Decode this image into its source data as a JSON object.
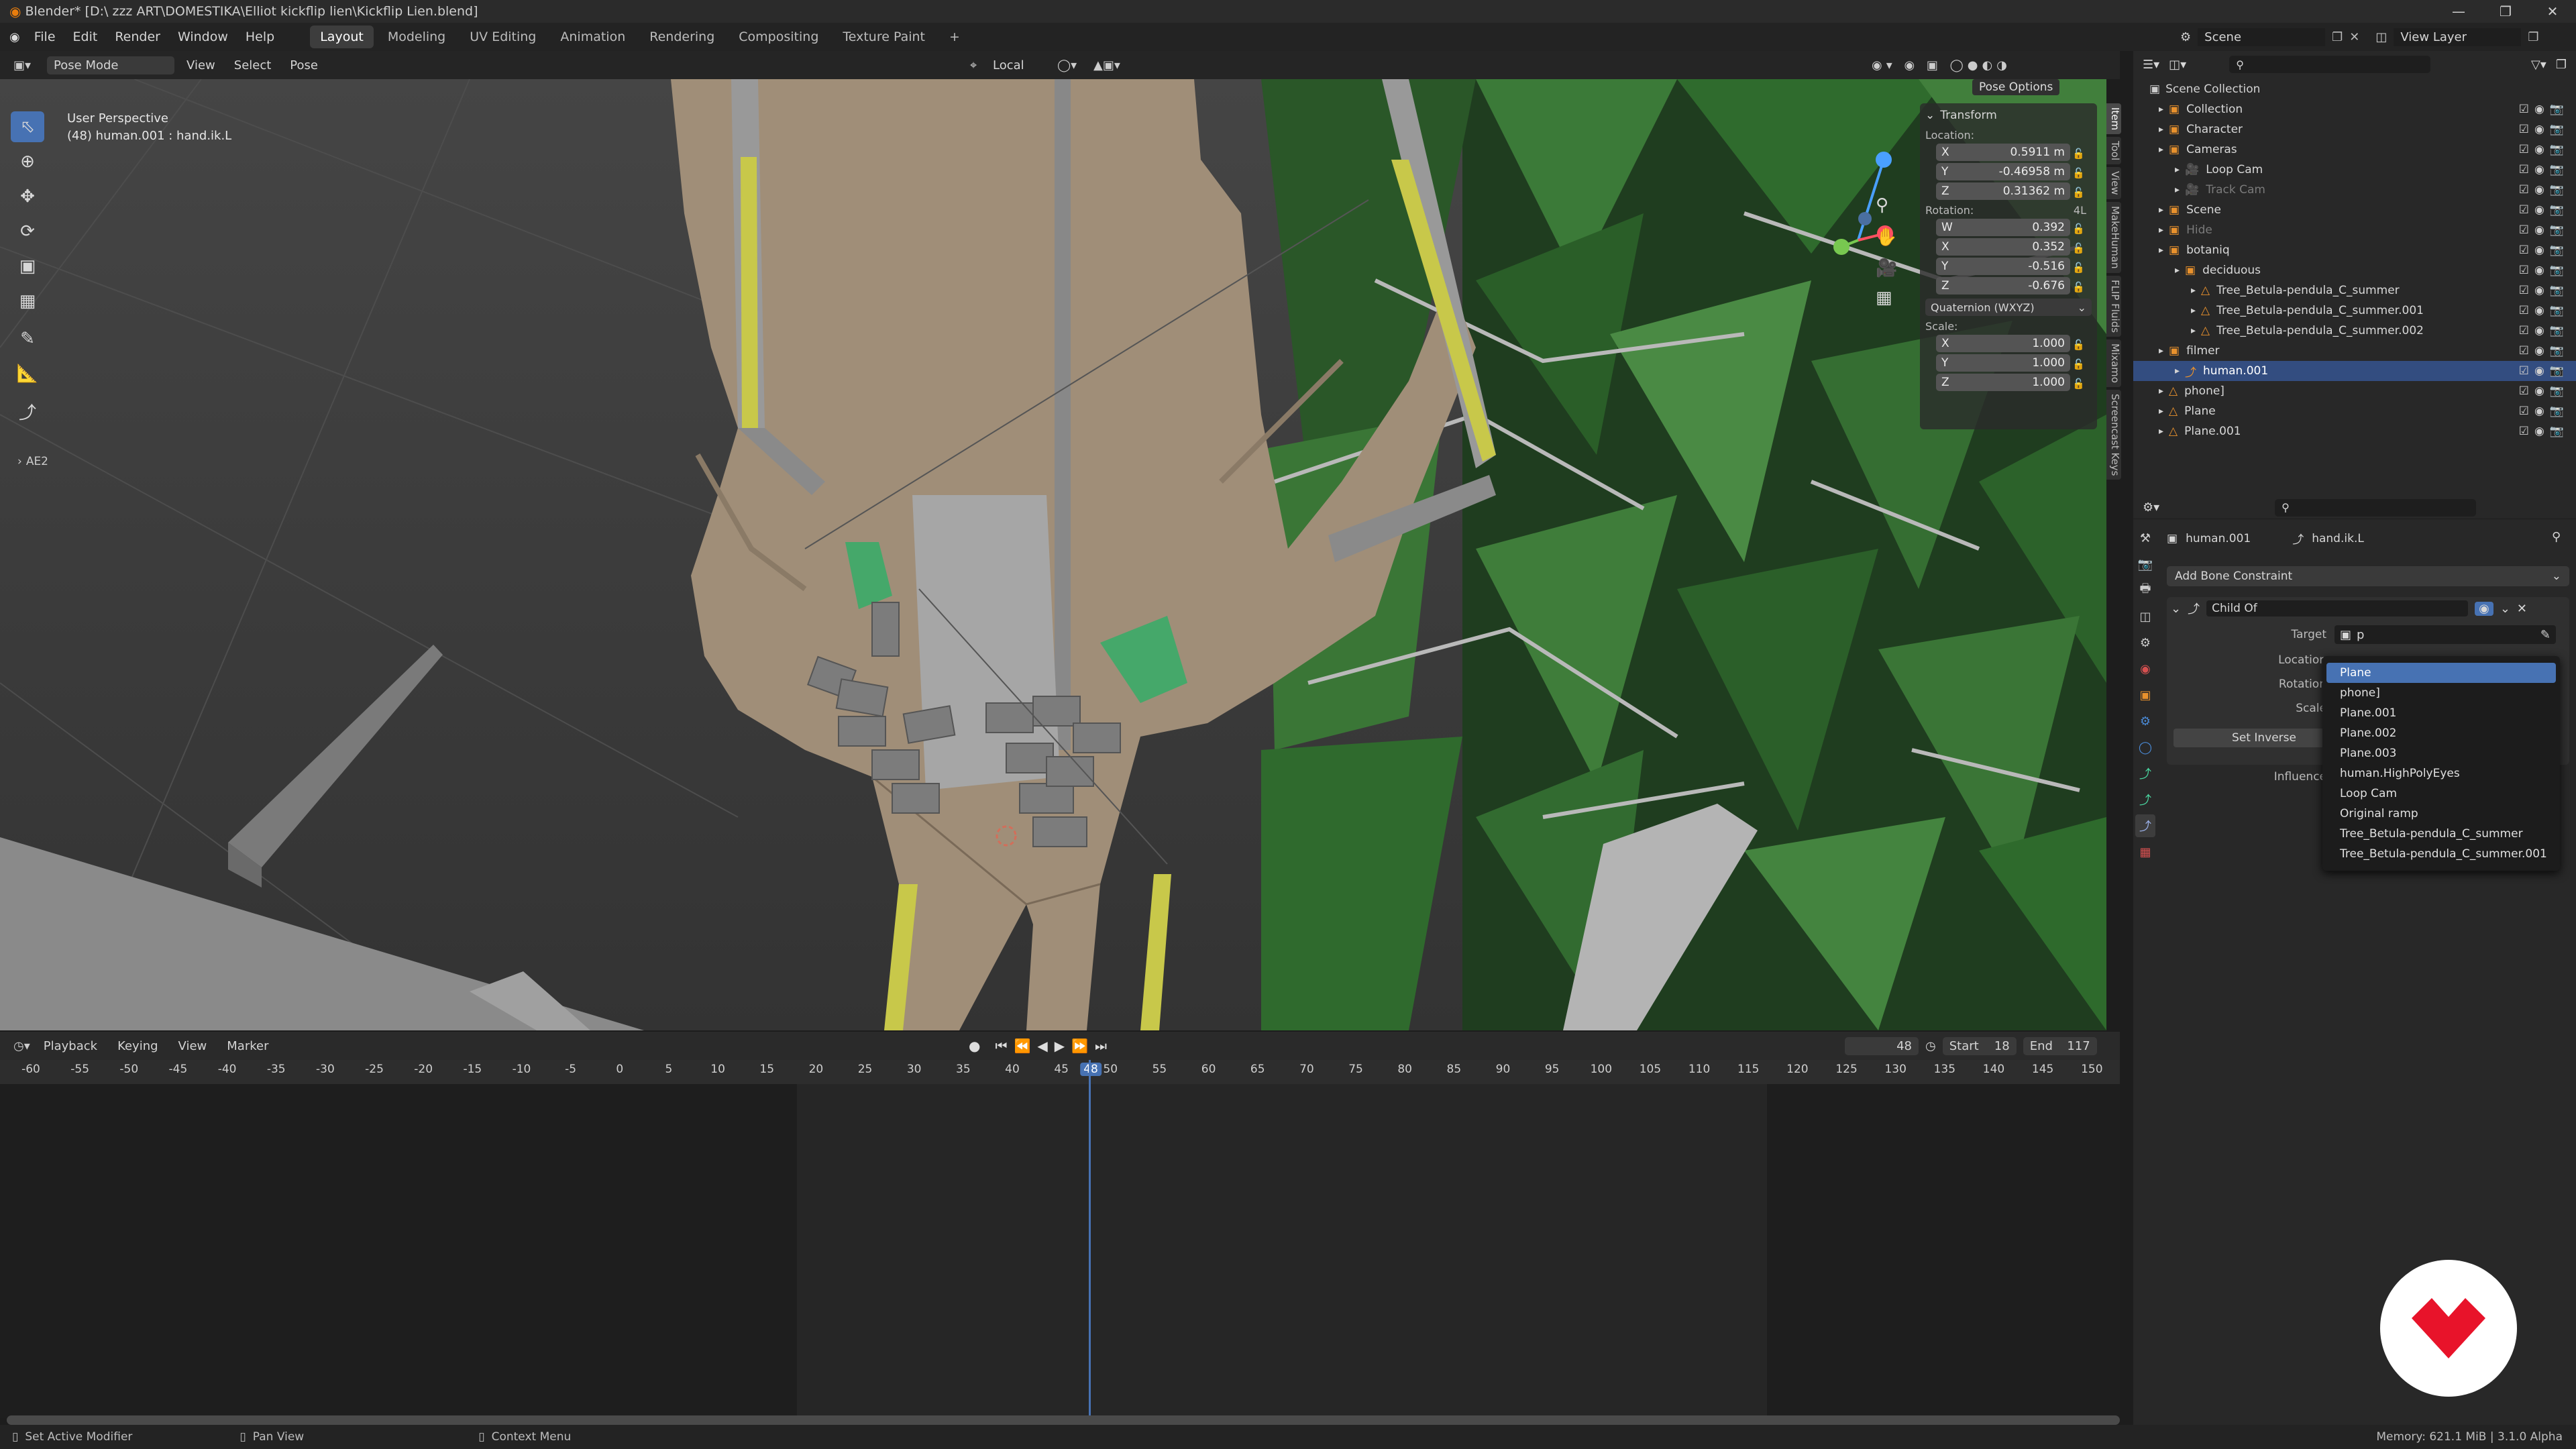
{
  "titlebar": {
    "title": "Blender* [D:\\ zzz ART\\DOMESTIKA\\Elliot kickflip lien\\Kickflip Lien.blend]"
  },
  "menu": {
    "items": [
      "File",
      "Edit",
      "Render",
      "Window",
      "Help"
    ]
  },
  "workspaces": [
    "Layout",
    "Modeling",
    "UV Editing",
    "Animation",
    "Rendering",
    "Compositing",
    "Texture Paint",
    "+"
  ],
  "top_right": {
    "scene": "Scene",
    "view_layer": "View Layer"
  },
  "viewport_header": {
    "mode": "Pose Mode",
    "menus": [
      "View",
      "Select",
      "Pose"
    ],
    "orientation": "Local",
    "pose_options": "Pose Options"
  },
  "viewport": {
    "perspective": "User Perspective",
    "object_info": "(48) human.001 : hand.ik.L",
    "collapsed_panel": "AE2"
  },
  "transform": {
    "title": "Transform",
    "location_label": "Location:",
    "location": [
      {
        "axis": "X",
        "value": "0.5911 m"
      },
      {
        "axis": "Y",
        "value": "-0.46958 m"
      },
      {
        "axis": "Z",
        "value": "0.31362 m"
      }
    ],
    "rotation_label": "Rotation:",
    "rotation_mode_short": "4L",
    "rotation": [
      {
        "axis": "W",
        "value": "0.392"
      },
      {
        "axis": "X",
        "value": "0.352"
      },
      {
        "axis": "Y",
        "value": "-0.516"
      },
      {
        "axis": "Z",
        "value": "-0.676"
      }
    ],
    "rotation_mode": "Quaternion (WXYZ)",
    "scale_label": "Scale:",
    "scale": [
      {
        "axis": "X",
        "value": "1.000"
      },
      {
        "axis": "Y",
        "value": "1.000"
      },
      {
        "axis": "Z",
        "value": "1.000"
      }
    ]
  },
  "side_tabs": [
    "Item",
    "Tool",
    "View",
    "MakeHuman",
    "FLIP Fluids",
    "Mixamo",
    "Screencast Keys"
  ],
  "timeline": {
    "menus": [
      "Playback",
      "Keying",
      "View",
      "Marker"
    ],
    "current_frame": "48",
    "start_label": "Start",
    "start": "18",
    "end_label": "End",
    "end": "117",
    "ticks": [
      "-60",
      "-55",
      "-50",
      "-45",
      "-40",
      "-35",
      "-30",
      "-25",
      "-20",
      "-15",
      "-10",
      "-5",
      "0",
      "5",
      "10",
      "15",
      "20",
      "25",
      "30",
      "35",
      "40",
      "45",
      "48",
      "50",
      "55",
      "60",
      "65",
      "70",
      "75",
      "80",
      "85",
      "90",
      "95",
      "100",
      "105",
      "110",
      "115",
      "120",
      "125",
      "130",
      "135",
      "140",
      "145",
      "150"
    ]
  },
  "outliner": {
    "root": "Scene Collection",
    "rows": [
      {
        "label": "Collection",
        "indent": 1,
        "color": "#d8d8d8"
      },
      {
        "label": "Character",
        "indent": 1,
        "color": "#d8d8d8"
      },
      {
        "label": "Cameras",
        "indent": 1,
        "color": "#d8d8d8"
      },
      {
        "label": "Loop Cam",
        "indent": 2,
        "color": "#d8d8d8"
      },
      {
        "label": "Track Cam",
        "indent": 2,
        "color": "#7a7a7a"
      },
      {
        "label": "Scene",
        "indent": 1,
        "color": "#d8d8d8"
      },
      {
        "label": "Hide",
        "indent": 1,
        "color": "#7a7a7a"
      },
      {
        "label": "botaniq",
        "indent": 1,
        "color": "#d8d8d8"
      },
      {
        "label": "deciduous",
        "indent": 2,
        "color": "#d8d8d8"
      },
      {
        "label": "Tree_Betula-pendula_C_summer",
        "indent": 3,
        "color": "#d8d8d8"
      },
      {
        "label": "Tree_Betula-pendula_C_summer.001",
        "indent": 3,
        "color": "#d8d8d8"
      },
      {
        "label": "Tree_Betula-pendula_C_summer.002",
        "indent": 3,
        "color": "#d8d8d8"
      },
      {
        "label": "filmer",
        "indent": 1,
        "color": "#d8d8d8"
      },
      {
        "label": "human.001",
        "indent": 2,
        "color": "#ffffff"
      },
      {
        "label": "phone]",
        "indent": 1,
        "color": "#d8d8d8"
      },
      {
        "label": "Plane",
        "indent": 1,
        "color": "#d8d8d8"
      },
      {
        "label": "Plane.001",
        "indent": 1,
        "color": "#d8d8d8"
      }
    ]
  },
  "properties": {
    "object": "human.001",
    "bone": "hand.ik.L",
    "add_constraint": "Add Bone Constraint",
    "constraint_name": "Child Of",
    "target_label": "Target",
    "target_value": "p",
    "labels": [
      "Location",
      "Rotation",
      "Scale"
    ],
    "set_inverse": "Set Inverse",
    "influence_label": "Influence"
  },
  "dropdown": {
    "items": [
      "Plane",
      "phone]",
      "Plane.001",
      "Plane.002",
      "Plane.003",
      "human.HighPolyEyes",
      "Loop Cam",
      "Original ramp",
      "Tree_Betula-pendula_C_summer",
      "Tree_Betula-pendula_C_summer.001"
    ],
    "highlighted": 0
  },
  "statusbar": {
    "left": "Set Active Modifier",
    "mid": "Pan View",
    "right": "Context Menu",
    "memory": "Memory: 621.1 MiB | 3.1.0 Alpha"
  },
  "colors": {
    "accent": "#4772b3",
    "bone_yellow": "#c8c84a",
    "skin": "#a08e78",
    "foliage": "#2f5a2e",
    "logo_red": "#e8132a"
  }
}
